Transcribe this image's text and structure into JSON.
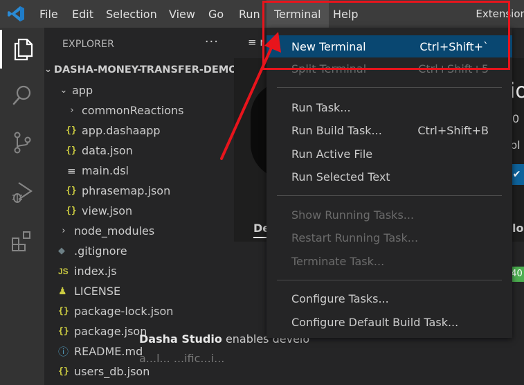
{
  "menubar": {
    "items": [
      "File",
      "Edit",
      "Selection",
      "View",
      "Go",
      "Run",
      "Terminal",
      "Help"
    ],
    "active": "Terminal",
    "extension_label": "Extension"
  },
  "activitybar": {
    "icons": [
      "explorer-icon",
      "search-icon",
      "source-control-icon",
      "run-debug-icon",
      "extensions-icon"
    ]
  },
  "sidebar": {
    "title": "EXPLORER",
    "more": "···",
    "root": "DASHA-MONEY-TRANSFER-DEMO",
    "items": [
      {
        "label": "app",
        "kind": "folder-open"
      },
      {
        "label": "commonReactions",
        "kind": "folder"
      },
      {
        "label": "app.dashaapp",
        "kind": "json"
      },
      {
        "label": "data.json",
        "kind": "json"
      },
      {
        "label": "main.dsl",
        "kind": "dsl"
      },
      {
        "label": "phrasemap.json",
        "kind": "json"
      },
      {
        "label": "view.json",
        "kind": "json"
      },
      {
        "label": "node_modules",
        "kind": "folder"
      },
      {
        "label": ".gitignore",
        "kind": "git"
      },
      {
        "label": "index.js",
        "kind": "js"
      },
      {
        "label": "LICENSE",
        "kind": "license"
      },
      {
        "label": "package-lock.json",
        "kind": "json"
      },
      {
        "label": "package.json",
        "kind": "json"
      },
      {
        "label": "README.md",
        "kind": "info"
      },
      {
        "label": "users_db.json",
        "kind": "json"
      }
    ]
  },
  "terminal_menu": {
    "items": [
      {
        "label": "New Terminal",
        "shortcut": "Ctrl+Shift+`",
        "state": "highlight"
      },
      {
        "label": "Split Terminal",
        "shortcut": "Ctrl+Shift+5",
        "state": "disabled"
      },
      {
        "label": "Run Task...",
        "shortcut": "",
        "state": "normal"
      },
      {
        "label": "Run Build Task...",
        "shortcut": "Ctrl+Shift+B",
        "state": "normal"
      },
      {
        "label": "Run Active File",
        "shortcut": "",
        "state": "normal"
      },
      {
        "label": "Run Selected Text",
        "shortcut": "",
        "state": "normal"
      },
      {
        "label": "Show Running Tasks...",
        "shortcut": "",
        "state": "disabled"
      },
      {
        "label": "Restart Running Task...",
        "shortcut": "",
        "state": "disabled"
      },
      {
        "label": "Terminate Task...",
        "shortcut": "",
        "state": "disabled"
      },
      {
        "label": "Configure Tasks...",
        "shortcut": "",
        "state": "normal"
      },
      {
        "label": "Configure Default Build Task...",
        "shortcut": "",
        "state": "normal"
      }
    ]
  },
  "editor": {
    "tab_icon": "≡ r",
    "frag_title": "io",
    "frag_version": "0",
    "frag_desc": "pl",
    "frag_tab": "De",
    "frag_lo": "lo",
    "badge": "40",
    "description_bold": "Dasha Studio",
    "description_rest": " enables develo",
    "description_clip": "a...l...   ...ific...i..."
  },
  "colors": {
    "accent_highlight": "#094771",
    "annotation_red": "#e8141c",
    "vscode_blue": "#0e639c",
    "json_yellow": "#cbcb41"
  }
}
